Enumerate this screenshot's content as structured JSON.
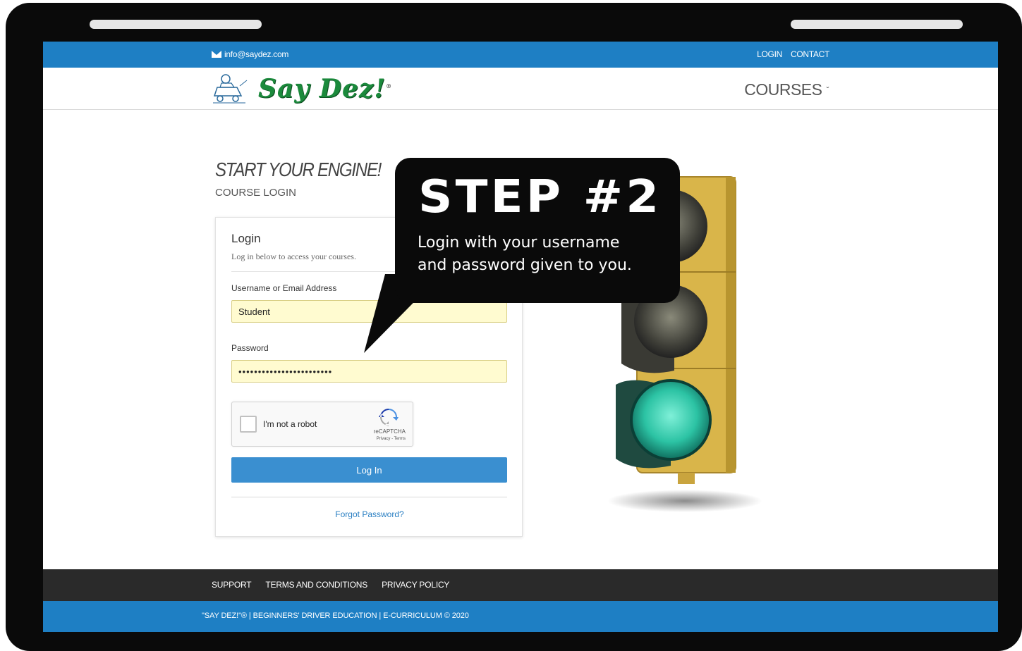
{
  "topbar": {
    "email": "info@saydez.com",
    "login_link": "LOGIN",
    "contact_link": "CONTACT"
  },
  "header": {
    "logo_text": "Say Dez!",
    "logo_mark": "®",
    "courses_menu": "COURSES"
  },
  "hero": {
    "title": "START YOUR ENGINE!",
    "subtitle": "COURSE LOGIN"
  },
  "login_card": {
    "title": "Login",
    "description": "Log in below to access your courses.",
    "username_label": "Username or Email Address",
    "username_value": "Student",
    "password_label": "Password",
    "password_mask": "••••••••••••••••••••••••",
    "captcha_label": "I'm not a robot",
    "captcha_brand": "reCAPTCHA",
    "captcha_terms": "Privacy - Terms",
    "login_button": "Log In",
    "forgot_link": "Forgot Password?"
  },
  "callout": {
    "title": "STEP #2",
    "text_line1": "Login with your username",
    "text_line2": "and password given to you."
  },
  "footer": {
    "nav": [
      "SUPPORT",
      "TERMS AND CONDITIONS",
      "PRIVACY POLICY"
    ],
    "copyright": "\"SAY DEZ!\"® | BEGINNERS' DRIVER EDUCATION | E-CURRICULUM © 2020"
  },
  "colors": {
    "brand_blue": "#1e7fc4",
    "button_blue": "#3a8fd0",
    "logo_green": "#1b8a3c",
    "input_yellow": "#fffbd0",
    "footer_dark": "#2a2a2a"
  },
  "icons": [
    "mail-icon",
    "chevron-down-icon",
    "recaptcha-icon",
    "traffic-light-image",
    "driver-logo-icon"
  ]
}
